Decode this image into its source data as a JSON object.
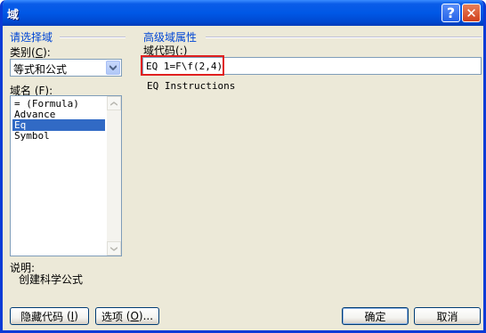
{
  "window": {
    "title": "域"
  },
  "left_panel": {
    "section_title": "请选择域",
    "category_label": "类别",
    "category_hotkey": "C",
    "category_value": "等式和公式",
    "field_names_label": "域名",
    "field_names_hotkey": "F",
    "field_names": [
      {
        "label": "= (Formula)",
        "selected": false
      },
      {
        "label": "Advance",
        "selected": false
      },
      {
        "label": "Eq",
        "selected": true
      },
      {
        "label": "Symbol",
        "selected": false
      }
    ],
    "description_label": "说明:",
    "description_text": "创建科学公式"
  },
  "right_panel": {
    "section_title": "高级域属性",
    "field_code_label": "域代码",
    "field_code_hotkey": ":",
    "field_code_value": "EQ 1=F\\f(2,4)",
    "instructions": "EQ Instructions"
  },
  "buttons": {
    "hide_codes": "隐藏代码",
    "hide_codes_hotkey": "I",
    "options": "选项",
    "options_hotkey": "O",
    "ok": "确定",
    "cancel": "取消"
  },
  "colors": {
    "accent": "#0046D5",
    "highlight_border": "#E02020",
    "selection": "#316AC5"
  }
}
